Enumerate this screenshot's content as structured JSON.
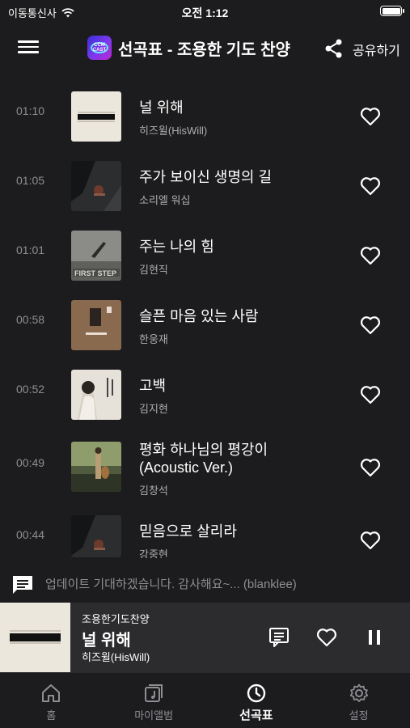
{
  "status": {
    "carrier": "이동통신사",
    "time": "오전 1:12"
  },
  "header": {
    "title": "선곡표 - 조용한 기도 찬양",
    "share_label": "공유하기",
    "logo_text": "CCM CAST"
  },
  "songs": [
    {
      "time": "01:10",
      "title": "널 위해",
      "title2": "",
      "artist": "히즈윌(HisWill)"
    },
    {
      "time": "01:05",
      "title": "주가 보이신 생명의 길",
      "title2": "",
      "artist": "소리엘 워십"
    },
    {
      "time": "01:01",
      "title": "주는 나의 힘",
      "title2": "",
      "artist": "김현직"
    },
    {
      "time": "00:58",
      "title": "슬픈 마음 있는 사람",
      "title2": "",
      "artist": "한웅재"
    },
    {
      "time": "00:52",
      "title": "고백",
      "title2": "",
      "artist": "김지현"
    },
    {
      "time": "00:49",
      "title": "평화 하나님의 평강이",
      "title2": "(Acoustic Ver.)",
      "artist": "김창석"
    },
    {
      "time": "00:44",
      "title": "믿음으로 살리라",
      "title2": "",
      "artist": "강중현"
    }
  ],
  "comment": {
    "text": "업데이트 기대하겠습니다. 감사해요~... (blanklee)"
  },
  "player": {
    "album": "조용한기도찬양",
    "title": "널 위해",
    "artist": "히즈윌(HisWill)"
  },
  "tabs": [
    {
      "label": "홈",
      "icon": "home-icon"
    },
    {
      "label": "마이앨범",
      "icon": "album-icon"
    },
    {
      "label": "선곡표",
      "icon": "clock-icon",
      "active": true
    },
    {
      "label": "설정",
      "icon": "gear-icon"
    }
  ],
  "colors": {
    "background": "#1c1c1e",
    "player_bg": "#2c2c2e",
    "secondary_text": "#8e8e93"
  }
}
